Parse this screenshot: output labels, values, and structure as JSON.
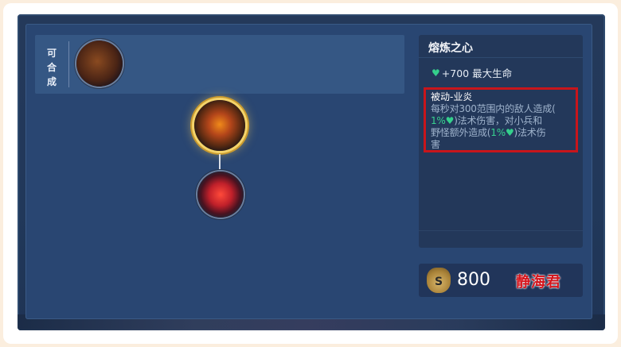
{
  "craft": {
    "label": "可合成"
  },
  "item": {
    "name": "熔炼之心",
    "stat_text": "+700 最大生命",
    "passive_name": "被动-业炎",
    "passive_desc_1": "每秒对300范围内的敌人造成(",
    "passive_pct_1": "1%",
    "passive_desc_2": ")法术伤害，对小兵和",
    "passive_desc_3": "野怪额外造成(",
    "passive_pct_2": "1%",
    "passive_desc_4": ")法术伤",
    "passive_desc_5": "害"
  },
  "price": {
    "bag_icon_letter": "S",
    "value": "800"
  },
  "watermark": "静海君",
  "colors": {
    "panel": "#294672",
    "highlight_box": "#c8151b",
    "heart": "#34d08c"
  },
  "icons": {
    "heart": "green-heart-icon",
    "coin_bag": "coin-bag-icon"
  }
}
